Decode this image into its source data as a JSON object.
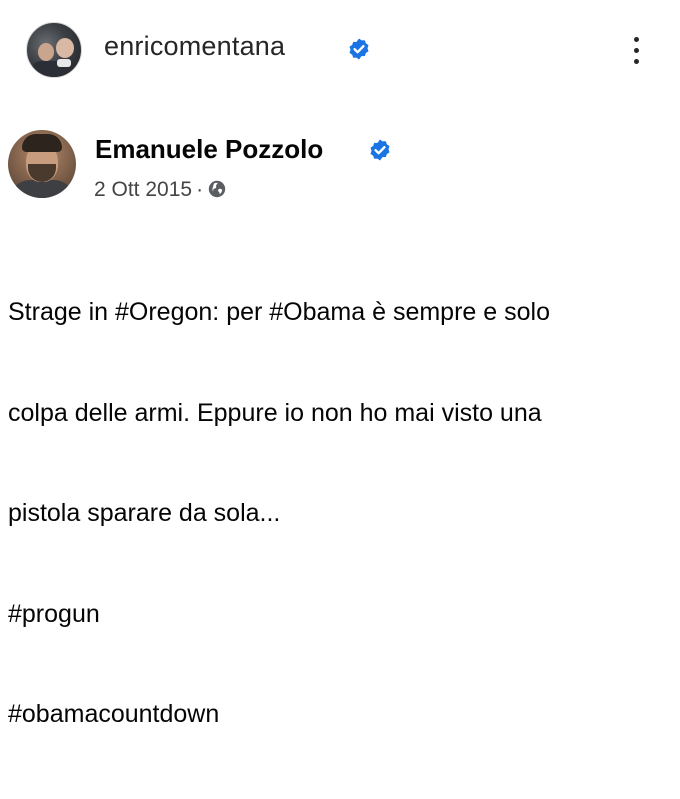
{
  "instagram_header": {
    "username": "enricomentana",
    "verified_icon": "verified-badge-icon",
    "more_icon": "more-options-icon"
  },
  "facebook_post": {
    "author": "Emanuele Pozzolo",
    "verified_icon": "verified-badge-icon",
    "date": "2 Ott 2015",
    "separator": "·",
    "audience_icon": "globe-icon",
    "text_lines": [
      "Strage in #Oregon: per #Obama è sempre e solo",
      "colpa delle armi. Eppure io non ho mai visto una",
      "pistola sparare da sola...",
      "#progun",
      "#obamacountdown"
    ]
  },
  "colors": {
    "verified_blue": "#1b74e4",
    "text_primary": "#050505",
    "text_secondary": "#444444"
  }
}
